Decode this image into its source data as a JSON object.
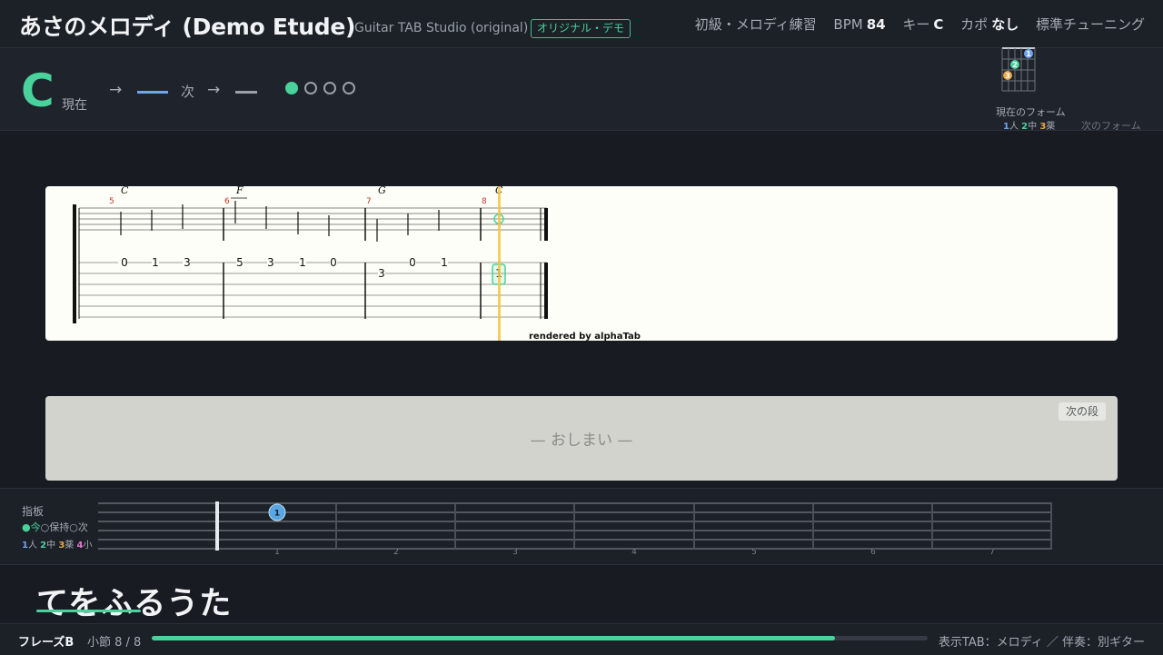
{
  "header": {
    "title": "あさのメロディ (Demo Etude)",
    "app_name": "Guitar TAB Studio (original)",
    "badge": "オリジナル・デモ",
    "level": "初級・メロディ練習",
    "bpm_label": "BPM",
    "bpm_value": "84",
    "key_label": "キー",
    "key_value": "C",
    "capo_label": "カポ",
    "capo_value": "なし",
    "tuning": "標準チューニング"
  },
  "chord_bar": {
    "current_chord": "C",
    "current_label": "現在",
    "arrow": "→",
    "next_label": "次",
    "beats_total": 4,
    "beat_active": 1,
    "form_label": "現在のフォーム",
    "finger_legend": [
      {
        "num": "1",
        "name": "人",
        "color": "#6fa4ee"
      },
      {
        "num": "2",
        "name": "中",
        "color": "#49d29b"
      },
      {
        "num": "3",
        "name": "薬",
        "color": "#e8a64a"
      }
    ],
    "next_form_label": "次のフォーム",
    "colors": {
      "accent": "#49d29b",
      "index": "#6fa4ee",
      "middle": "#49d29b",
      "ring": "#e8a64a",
      "pinky": "#e876d2"
    }
  },
  "tab": {
    "rendered_by": "rendered by alphaTab",
    "measures": [
      {
        "number": "5",
        "chord": "C",
        "notes": [
          {
            "fret": "0"
          },
          {
            "fret": "1"
          },
          {
            "fret": "3"
          }
        ]
      },
      {
        "number": "6",
        "chord": "F",
        "notes": [
          {
            "fret": "5"
          },
          {
            "fret": "3"
          },
          {
            "fret": "1"
          },
          {
            "fret": "0"
          }
        ]
      },
      {
        "number": "7",
        "chord": "G",
        "notes": [
          {
            "fret": "3"
          },
          {
            "fret": "0"
          },
          {
            "fret": "1"
          }
        ]
      },
      {
        "number": "8",
        "chord": "C",
        "notes": [
          {
            "fret": "1"
          }
        ]
      }
    ]
  },
  "next_section": {
    "button": "次の段",
    "message": "— おしまい —"
  },
  "fretboard": {
    "title": "指板",
    "legend_now": "●今",
    "legend_hold": "○保持",
    "legend_next": "○次",
    "finger_legend": [
      {
        "num": "1",
        "name": "人",
        "color": "#6fa4ee"
      },
      {
        "num": "2",
        "name": "中",
        "color": "#49d29b"
      },
      {
        "num": "3",
        "name": "薬",
        "color": "#e8a64a"
      },
      {
        "num": "4",
        "name": "小",
        "color": "#e876d2"
      }
    ],
    "fret_numbers": [
      "1",
      "2",
      "3",
      "4",
      "5",
      "6",
      "7"
    ],
    "active_note": {
      "fret": 1,
      "string": 2,
      "finger": "1"
    }
  },
  "lyric": {
    "text": "てをふるうた"
  },
  "footer": {
    "phrase": "フレーズB",
    "measure": "小節 8 / 8",
    "progress": 0.88,
    "info": "表示TAB：メロディ ／ 伴奏：別ギター"
  }
}
